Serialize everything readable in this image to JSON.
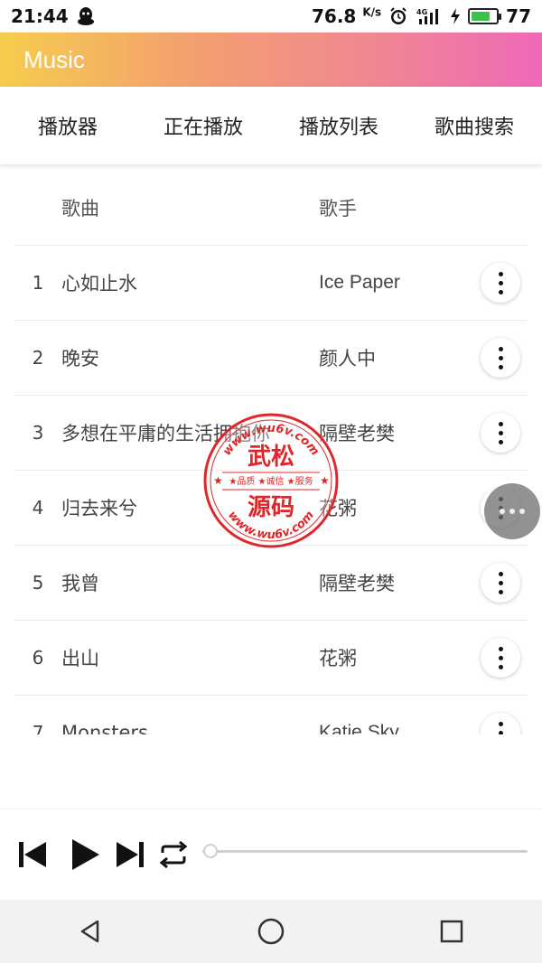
{
  "status_bar": {
    "time": "21:44",
    "net_speed": "76.8",
    "net_speed_unit": "K/s",
    "battery_level": "77",
    "battery_fraction": 0.77,
    "icons": [
      "qq-icon",
      "alarm-icon",
      "signal-4g-icon",
      "charging-icon",
      "battery-icon"
    ]
  },
  "app_bar": {
    "title": "Music",
    "gradient": [
      "#f6cd4d",
      "#f3a06f",
      "#f08a8d",
      "#ef69b8"
    ]
  },
  "tabs": [
    {
      "label": "播放器"
    },
    {
      "label": "正在播放"
    },
    {
      "label": "播放列表"
    },
    {
      "label": "歌曲搜索"
    }
  ],
  "table": {
    "headers": {
      "song": "歌曲",
      "artist": "歌手"
    },
    "rows": [
      {
        "num": "1",
        "song": "心如止水",
        "artist": "Ice Paper"
      },
      {
        "num": "2",
        "song": "晚安",
        "artist": "颜人中"
      },
      {
        "num": "3",
        "song": "多想在平庸的生活拥抱你",
        "artist": "隔壁老樊"
      },
      {
        "num": "4",
        "song": "归去来兮",
        "artist": "花粥"
      },
      {
        "num": "5",
        "song": "我曾",
        "artist": "隔壁老樊"
      },
      {
        "num": "6",
        "song": "出山",
        "artist": "花粥"
      },
      {
        "num": "7",
        "song": "Monsters",
        "artist": "Katie Sky"
      }
    ]
  },
  "watermark": {
    "top_arc": "www.wu6v.com",
    "title_top": "武松",
    "middle": "★品质 ★诚信 ★服务",
    "title_bottom": "源码",
    "bottom_arc": "www.wu6v.com",
    "color": "#e0262a"
  },
  "player": {
    "progress": 0.0,
    "icons": [
      "skip-previous-icon",
      "play-icon",
      "skip-next-icon",
      "repeat-icon"
    ]
  },
  "nav_bar": {
    "icons": [
      "back-icon",
      "home-icon",
      "recents-icon"
    ]
  }
}
